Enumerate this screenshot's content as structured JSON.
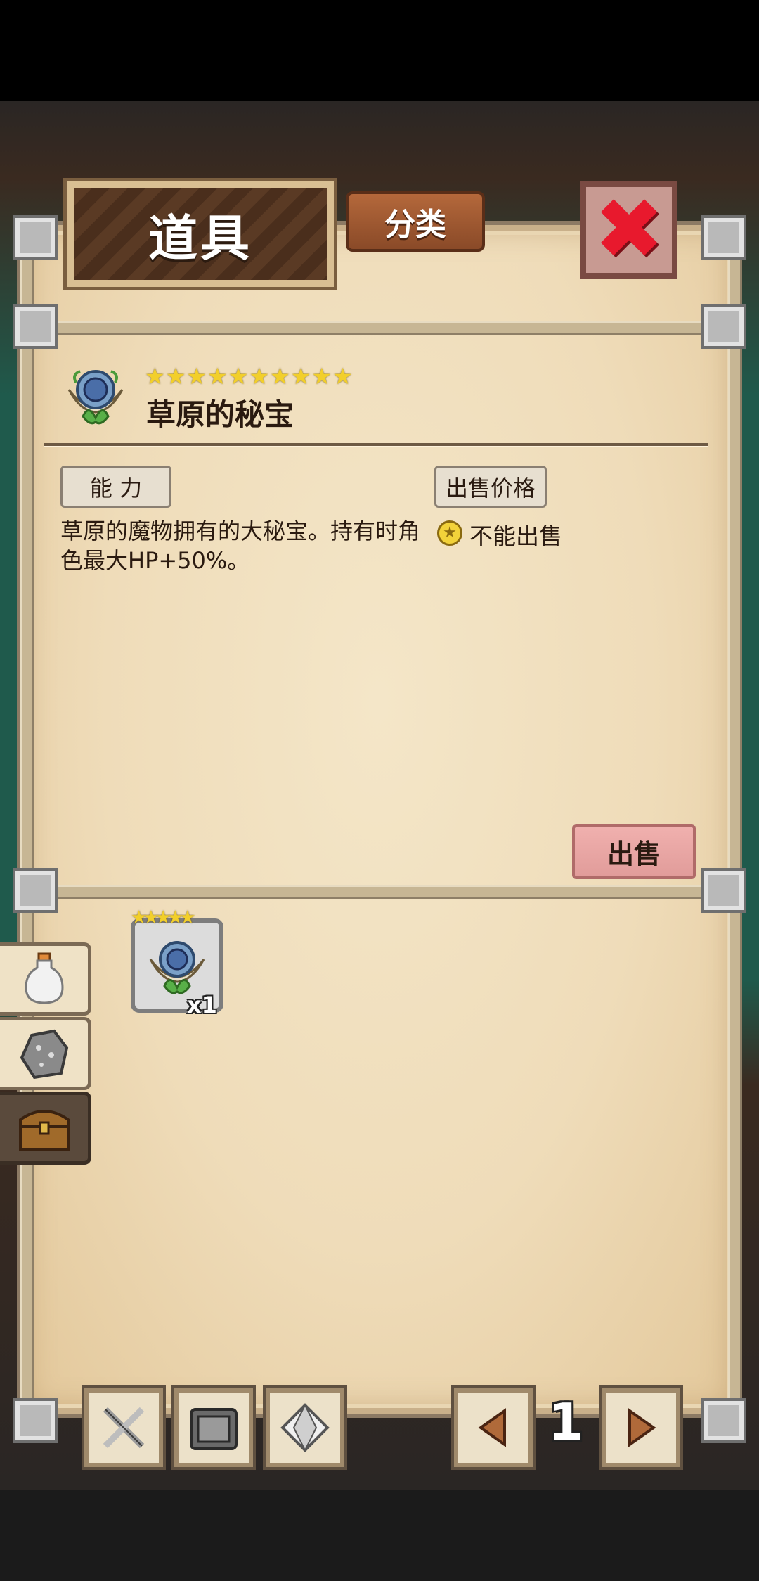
{
  "header": {
    "title": "道具",
    "category_label": "分类",
    "close_glyph": "✖"
  },
  "item": {
    "stars": "★★★★★★★★★★",
    "star_count": 10,
    "name": "草原的秘宝",
    "ability_label": "能 力",
    "price_label": "出售价格",
    "description": "草原的魔物拥有的大秘宝。持有时角色最大HP+50%。",
    "sell_status": "不能出售",
    "coin_glyph": "★",
    "sell_button": "出售"
  },
  "inventory": {
    "slot_stars": "★★★★★",
    "slot_count": "x1"
  },
  "side_tabs": [
    {
      "icon": "potion-icon"
    },
    {
      "icon": "ore-icon"
    },
    {
      "icon": "treasure-chest-icon",
      "active": true
    }
  ],
  "bottom_nav": {
    "icons": [
      "crossed-swords-icon",
      "armor-chest-icon",
      "diamond-icon"
    ],
    "page_number": "1"
  },
  "colors": {
    "parchment": "#efdcb9",
    "close": "#e8192d",
    "star": "#f2cf2b",
    "sell_button": "#e19c9a"
  }
}
